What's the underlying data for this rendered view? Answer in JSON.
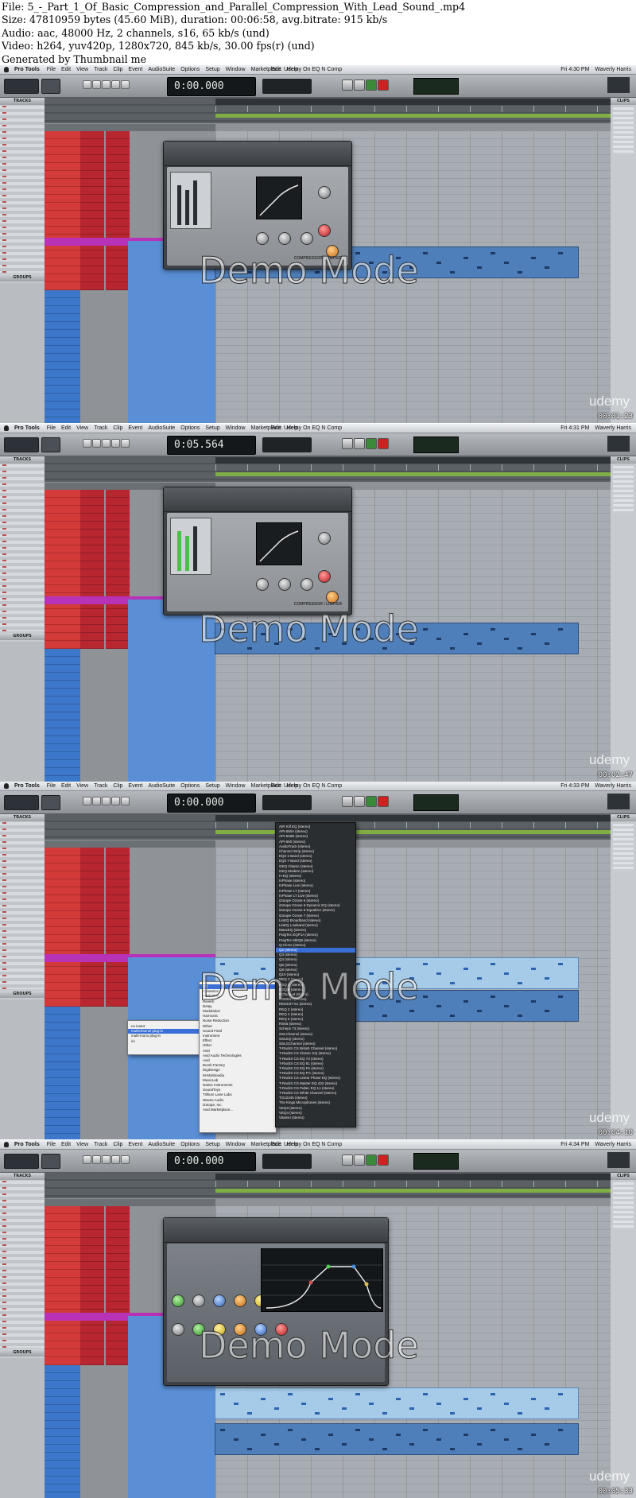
{
  "header": {
    "file": "File: 5_-_Part_1_Of_Basic_Compression_and_Parallel_Compression_With_Lead_Sound_.mp4",
    "size": "Size: 47810959 bytes (45.60 MiB), duration: 00:06:58, avg.bitrate: 915 kb/s",
    "audio": "Audio: aac, 48000 Hz, 2 channels, s16, 65 kb/s (und)",
    "video": "Video: h264, yuv420p, 1280x720, 845 kb/s, 30.00 fps(r) (und)",
    "generator": "Generated by Thumbnail me"
  },
  "menu": {
    "app": "Pro Tools",
    "items": [
      "File",
      "Edit",
      "View",
      "Track",
      "Clip",
      "Event",
      "AudioSuite",
      "Options",
      "Setup",
      "Window",
      "Marketplace",
      "Help"
    ],
    "user": "Waverly Harris"
  },
  "panels": {
    "tracks": "TRACKS",
    "groups": "GROUPS",
    "clips": "CLIPS"
  },
  "watermark": "Demo Mode",
  "brand": "udemy",
  "frames": [
    {
      "window_title": "Edit: Udemy On EQ N Comp",
      "counter": "0:00.000",
      "clock": "Fri 4:30 PM",
      "timestamp": "00:01:23",
      "plugin_name": "COMPRESSOR / LIMITER"
    },
    {
      "window_title": "Edit: Udemy On EQ N Comp",
      "counter": "0:05.564",
      "clock": "Fri 4:31 PM",
      "timestamp": "00:02:47",
      "plugin_name": "COMPRESSOR / LIMITER"
    },
    {
      "window_title": "Edit: Udemy On EQ N Comp",
      "counter": "0:00.000",
      "clock": "Fri 4:33 PM",
      "timestamp": "00:04:10"
    },
    {
      "window_title": "Edit: Udemy On EQ N Comp",
      "counter": "0:00.000",
      "clock": "Fri 4:34 PM",
      "timestamp": "00:05:33"
    }
  ],
  "insert_menu": {
    "items": [
      "no insert",
      "multichannel plug-in",
      "multi-mono plug-in",
      "i/o"
    ],
    "selected": "multichannel plug-in"
  },
  "category_menu": {
    "items": [
      "EQ",
      "Dynamics",
      "Pitch Shift",
      "Reverb",
      "Delay",
      "Modulation",
      "Harmonic",
      "Noise Reduction",
      "Dither",
      "Sound Field",
      "Instrument",
      "Effect",
      "Other",
      "",
      "Avid",
      "Avid Audio Technologies",
      "Avid",
      "Bomb Factory",
      "DigiDesign",
      "M-Multimedia",
      "MusicLab",
      "Native Instruments",
      "SoundToys",
      "Trillium Lane Labs",
      "Waves Audio",
      "iZotope, Inc.",
      "",
      "Avid Marketplace..."
    ],
    "selected": "EQ"
  },
  "eq_plugin_menu": {
    "items": [
      "AIR Kill EQ (stereo)",
      "API-550A (stereo)",
      "API-550B (stereo)",
      "API-560 (stereo)",
      "AudioTrack (stereo)",
      "Channel Strip (stereo)",
      "EQ3 1-Band (stereo)",
      "EQ3 7-Band (stereo)",
      "GEQ Classic (stereo)",
      "GEQ Modern (stereo)",
      "H-EQ (stereo)",
      "InPhase (stereo)",
      "InPhase Live (stereo)",
      "InPhase LT (stereo)",
      "InPhase LT Live (stereo)",
      "iZotope Ozone 6 (stereo)",
      "iZotope Ozone 6 Dynamic EQ (stereo)",
      "iZotope Ozone 6 Equalizer (stereo)",
      "iZotope Ozone 7 (stereo)",
      "LinEQ Broadband (stereo)",
      "LinEQ Lowband (stereo)",
      "MaxxEQ (stereo)",
      "PuigTec EQP1A (stereo)",
      "PuigTec MEQ5 (stereo)",
      "Q-Clone (stereo)",
      "Q2 (stereo)",
      "Q3 (stereo)",
      "Q4 (stereo)",
      "Q6 (stereo)",
      "Q8 (stereo)",
      "Q10 (stereo)",
      "REQ 2 (stereo)",
      "REQ 4 (stereo)",
      "REQ 6 (stereo)",
      "RChannel (stereo)",
      "REDD17 (stereo)",
      "REDD37-51 (stereo)",
      "REQ 2 (stereo)",
      "REQ 4 (stereo)",
      "REQ 6 (stereo)",
      "RS56 (stereo)",
      "Scheps 73 (stereo)",
      "SSLChannel (stereo)",
      "SSLEQ (stereo)",
      "SSLGChannel (stereo)",
      "T-RackS CS British Channel (stereo)",
      "T-RackS CS Classic EQ (stereo)",
      "T-RackS CS EQ 73 (stereo)",
      "T-RackS CS EQ 81 (stereo)",
      "T-RackS CS EQ PA (stereo)",
      "T-RackS CS EQ PC (stereo)",
      "T-RackS CS Linear Phase EQ (stereo)",
      "T-RackS CS Master EQ 432 (stereo)",
      "T-RackS CS Pultec EQ 1A (stereo)",
      "T-RackS CS White Channel (stereo)",
      "TG12345 (stereo)",
      "The Kings Microphones (stereo)",
      "VEQ3 (stereo)",
      "VEQ4 (stereo)",
      "Vitamin (stereo)"
    ],
    "selected": "Q2 (stereo)"
  },
  "colors": {
    "tracks_red": "#d33b3b",
    "tracks_blue": "#3d77c9",
    "bass_purple": "#b832b8",
    "marker_green": "#7fae45",
    "midi_blue": "#4f7fba"
  }
}
